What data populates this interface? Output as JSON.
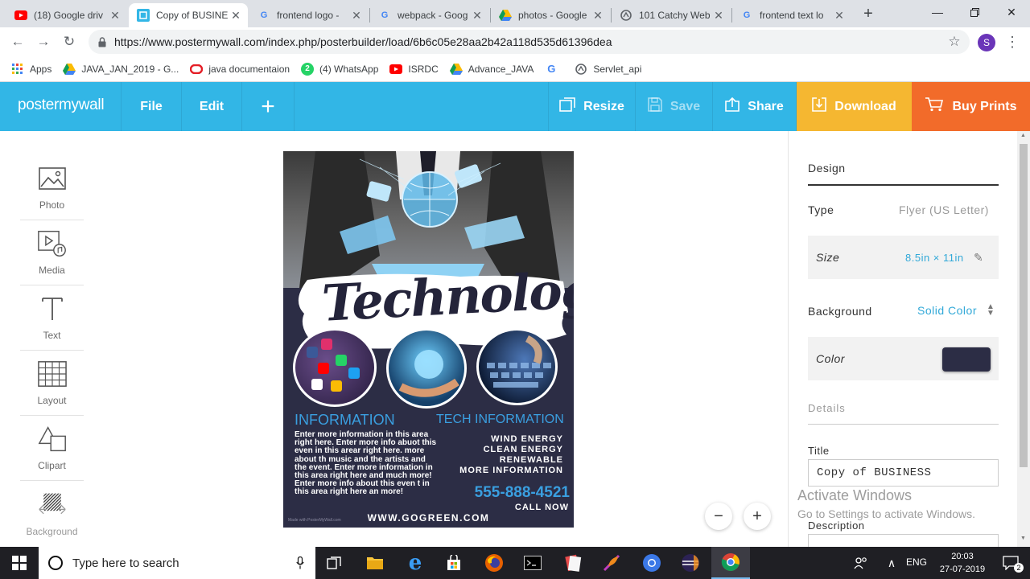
{
  "browser": {
    "tabs": [
      {
        "title": "(18) Google driv",
        "icon": "youtube-icon",
        "color": "#ff0000"
      },
      {
        "title": "Copy of BUSINE",
        "icon": "postermywall-icon",
        "color": "#32b6e6",
        "active": true
      },
      {
        "title": "frontend logo -",
        "icon": "google-icon",
        "color": "#4285f4"
      },
      {
        "title": "webpack - Goog",
        "icon": "google-icon",
        "color": "#4285f4"
      },
      {
        "title": "photos - Google",
        "icon": "google-drive-icon",
        "color": "#fbbc04"
      },
      {
        "title": "101 Catchy Web",
        "icon": "web-icon",
        "color": "#5f6368"
      },
      {
        "title": "frontend text lo",
        "icon": "google-icon",
        "color": "#4285f4"
      }
    ],
    "new_tab": "+",
    "url": "https://www.postermywall.com/index.php/posterbuilder/load/6b6c05e28aa2b42a118d535d61396dea",
    "profile_initial": "S",
    "bookmarks": [
      {
        "label": "Apps",
        "icon": "apps-grid-icon",
        "color": "#4285f4"
      },
      {
        "label": "JAVA_JAN_2019 - G...",
        "icon": "google-drive-icon",
        "color": "#fbbc04"
      },
      {
        "label": "java documentaion",
        "icon": "oracle-icon",
        "color": "#e41e26"
      },
      {
        "label": "(4) WhatsApp",
        "icon": "whatsapp-icon",
        "color": "#25d366"
      },
      {
        "label": "ISRDC",
        "icon": "youtube-icon",
        "color": "#ff0000"
      },
      {
        "label": "Advance_JAVA",
        "icon": "google-drive-icon",
        "color": "#fbbc04"
      },
      {
        "label": "",
        "icon": "google-icon",
        "color": "#4285f4"
      },
      {
        "label": "Servlet_api",
        "icon": "web-icon",
        "color": "#5f6368"
      }
    ]
  },
  "app": {
    "logo": "postermywall",
    "menu": {
      "file": "File",
      "edit": "Edit",
      "add": "+"
    },
    "actions": {
      "resize": "Resize",
      "save": "Save",
      "share": "Share",
      "download": "Download",
      "buy": "Buy Prints"
    },
    "colors": {
      "header": "#32b6e6",
      "download": "#f5b731",
      "buy": "#f26b2a"
    }
  },
  "tools": [
    {
      "label": "Photo",
      "icon": "photo-icon"
    },
    {
      "label": "Media",
      "icon": "media-icon"
    },
    {
      "label": "Text",
      "icon": "text-icon"
    },
    {
      "label": "Layout",
      "icon": "layout-icon"
    },
    {
      "label": "Clipart",
      "icon": "clipart-icon"
    },
    {
      "label": "Background",
      "icon": "background-icon"
    }
  ],
  "flyer": {
    "title": "Technology",
    "heading_left": "INFORMATION",
    "heading_right": "TECH INFORMATION",
    "body": "Enter more information in this area right here.  Enter more info abuot this even in this arear right here. more about th music and the artists and the event. Enter more information in this area right here and much more! Enter more info about this even t in this area right here an more!",
    "points": [
      "WIND ENERGY",
      "CLEAN ENERGY",
      "RENEWABLE",
      "MORE INFORMATION"
    ],
    "phone": "555-888-4521",
    "cta": "CALL NOW",
    "website": "WWW.GOGREEN.COM",
    "watermark": "Made with PosterMyWall.com",
    "accent": "#3a9fe0"
  },
  "zoom": {
    "out": "−",
    "in": "+"
  },
  "panel": {
    "tab": "Design",
    "type_label": "Type",
    "type_value": "Flyer (US Letter)",
    "size_label": "Size",
    "size_value": "8.5in × 11in",
    "background_label": "Background",
    "background_value": "Solid Color",
    "color_label": "Color",
    "color_swatch": "#2c2d45",
    "details_label": "Details",
    "title_label": "Title",
    "title_value": "Copy of BUSINESS",
    "description_label": "Description"
  },
  "watermark_windows": {
    "title": "Activate Windows",
    "subtitle": "Go to Settings to activate Windows."
  },
  "taskbar": {
    "search_placeholder": "Type here to search",
    "lang": "ENG",
    "time": "20:03",
    "date": "27-07-2019",
    "notifications": "2"
  }
}
